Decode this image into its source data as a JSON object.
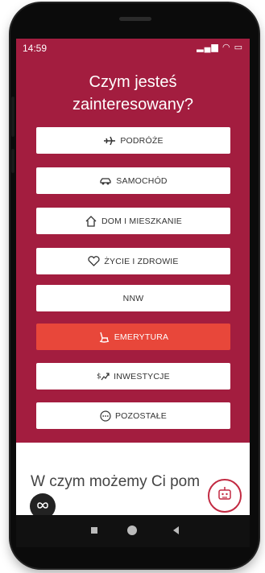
{
  "status": {
    "time": "14:59",
    "icons": "▂▄▆ ◠ ▭"
  },
  "question": {
    "line1": "Czym jesteś",
    "line2": "zainteresowany?"
  },
  "options": [
    {
      "label": "PODRÓŻE",
      "icon": "plane-icon",
      "active": false
    },
    {
      "label": "SAMOCHÓD",
      "icon": "car-icon",
      "active": false
    },
    {
      "label": "DOM I MIESZKANIE",
      "icon": "house-icon",
      "active": false
    },
    {
      "label": "ŻYCIE I ZDROWIE",
      "icon": "heart-icon",
      "active": false
    },
    {
      "label": "NNW",
      "icon": "",
      "active": false
    },
    {
      "label": "EMERYTURA",
      "icon": "rocking-chair-icon",
      "active": true
    },
    {
      "label": "INWESTYCJE",
      "icon": "money-chart-icon",
      "active": false
    },
    {
      "label": "POZOSTAŁE",
      "icon": "more-icon",
      "active": false
    }
  ],
  "help_heading": "W czym możemy Ci pom",
  "colors": {
    "brand": "#a31d3f",
    "active": "#e8473a"
  }
}
